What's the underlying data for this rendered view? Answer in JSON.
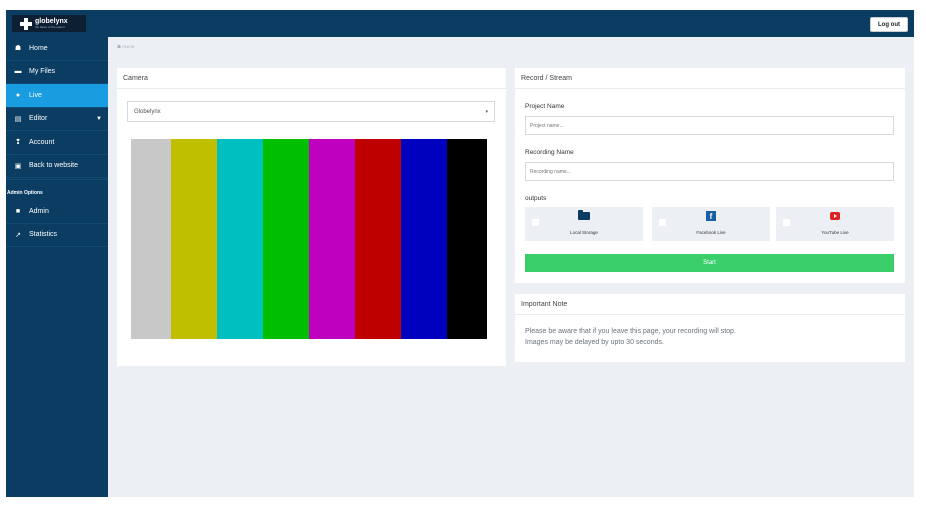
{
  "header": {
    "brand_name": "globelynx",
    "brand_tagline": "the faces of the expert",
    "logout_label": "Log out"
  },
  "sidebar": {
    "items": [
      {
        "label": "Home",
        "icon": "home-icon"
      },
      {
        "label": "My Files",
        "icon": "folder-icon"
      },
      {
        "label": "Live",
        "icon": "live-dot-icon",
        "active": true
      },
      {
        "label": "Editor",
        "icon": "film-icon",
        "has_dropdown": true
      },
      {
        "label": "Account",
        "icon": "user-circle-icon"
      },
      {
        "label": "Back to website",
        "icon": "external-link-icon"
      }
    ],
    "admin_section_title": "Admin Options",
    "admin_items": [
      {
        "label": "Admin",
        "icon": "lock-icon"
      },
      {
        "label": "Statistics",
        "icon": "chart-icon"
      }
    ]
  },
  "breadcrumb": {
    "label": "Home",
    "icon": "home-icon"
  },
  "camera": {
    "title": "Camera",
    "selected_source": "Globelynx",
    "color_bars": [
      "#c8c8c8",
      "#bfbf00",
      "#00bfbf",
      "#00bf00",
      "#bf00bf",
      "#bf0000",
      "#0000bf",
      "#000000"
    ]
  },
  "record": {
    "title": "Record / Stream",
    "project_label": "Project Name",
    "project_placeholder": "Project name...",
    "recording_label": "Recording Name",
    "recording_placeholder": "Recording name...",
    "outputs_label": "outputs",
    "outputs": [
      {
        "label": "Local Storage",
        "icon": "folder-open-icon"
      },
      {
        "label": "Facebook Live",
        "icon": "facebook-icon"
      },
      {
        "label": "YouTube Live",
        "icon": "youtube-icon"
      }
    ],
    "start_label": "Start",
    "start_color": "#3ace6a"
  },
  "note": {
    "title": "Important Note",
    "line1": "Please be aware that if you leave this page, your recording will stop.",
    "line2": "Images may be delayed by upto 30 seconds."
  },
  "colors": {
    "nav_bg": "#0b3d63",
    "active": "#1a9de0",
    "page_bg": "#ecf0f4"
  }
}
